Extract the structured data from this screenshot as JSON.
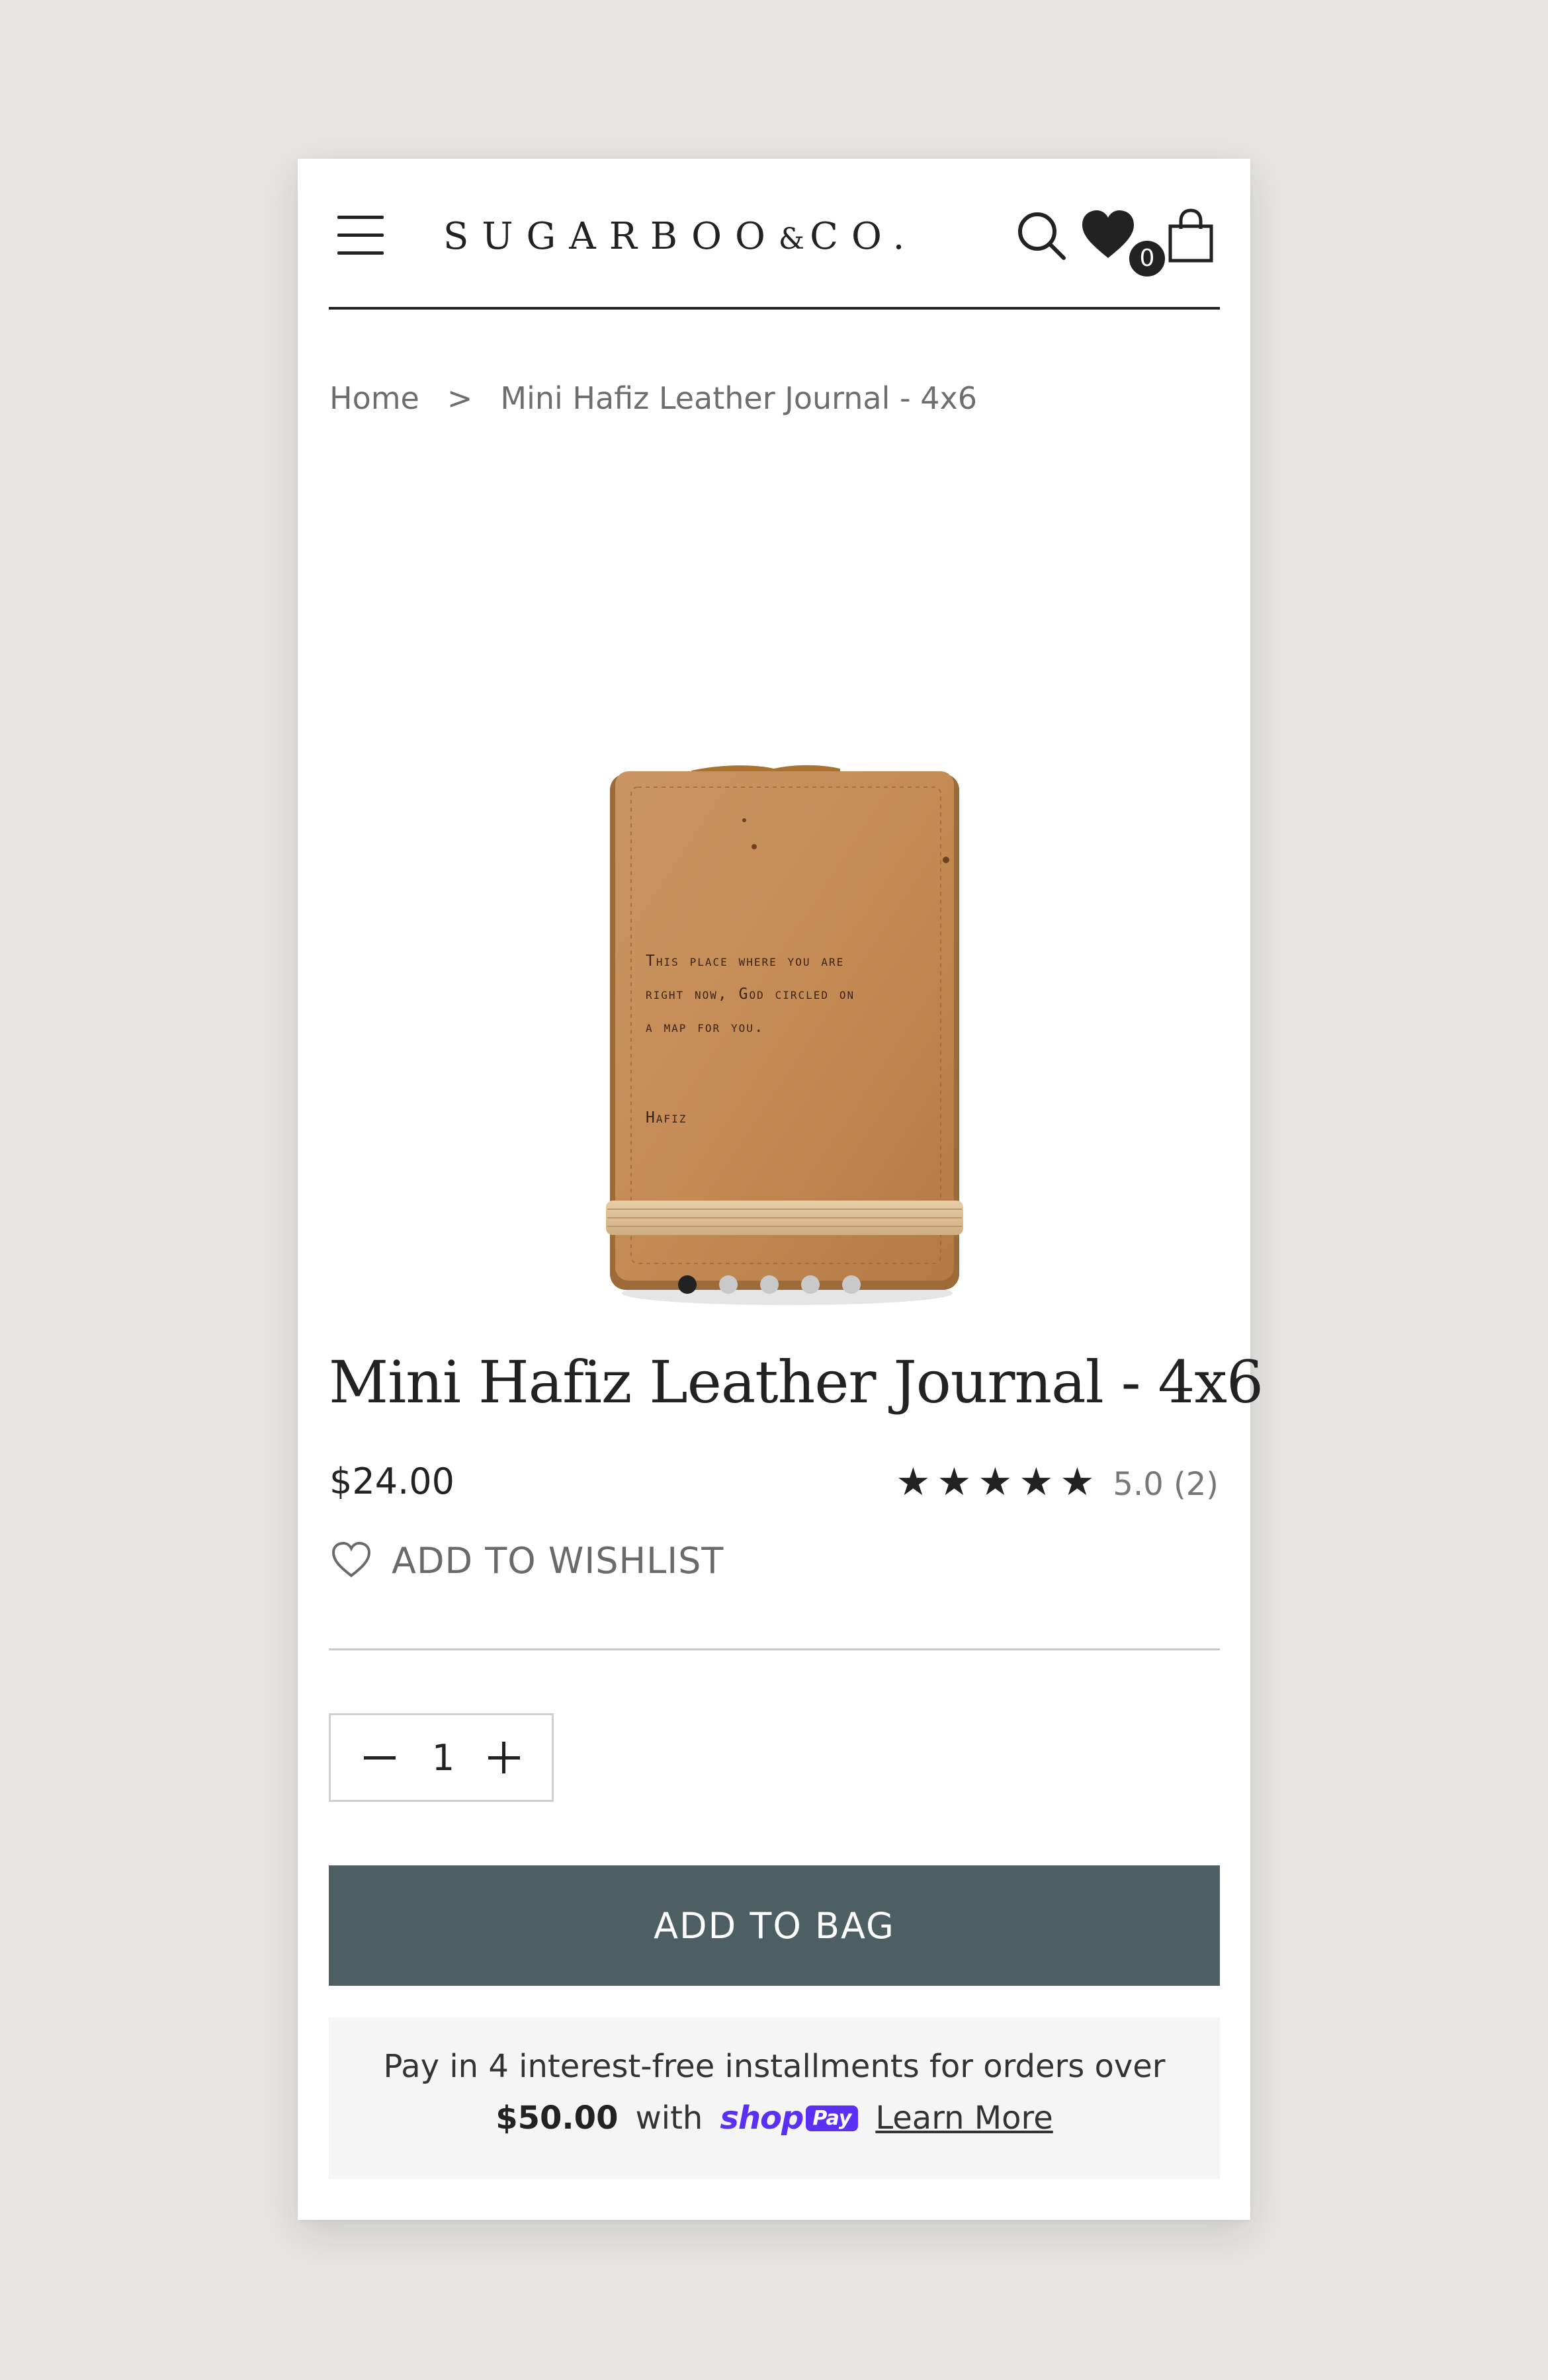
{
  "header": {
    "brand_main": "SUGARBOO",
    "brand_amp": "&",
    "brand_tail": "CO.",
    "cart_count": "0",
    "icons": [
      "menu-icon",
      "search-icon",
      "heart-icon",
      "bag-icon"
    ]
  },
  "breadcrumb": {
    "home": "Home",
    "separator": ">",
    "current": "Mini Hafiz Leather Journal - 4x6"
  },
  "product": {
    "image_text": {
      "quote_line1": "This place where you are",
      "quote_line2": "right now, God circled on",
      "quote_line3": "a map for you.",
      "author": "Hafiz"
    },
    "gallery_count": 5,
    "gallery_active": 1,
    "title": "Mini Hafiz Leather Journal - 4x6",
    "price": "$24.00",
    "rating_stars": "★★★★★",
    "rating_value": 5.0,
    "rating_text": "5.0 (2)",
    "wishlist_label": "ADD TO WISHLIST",
    "quantity": "1",
    "add_to_bag_label": "ADD TO BAG"
  },
  "installments": {
    "line1": "Pay in 4 interest-free installments for orders over",
    "amount": "$50.00",
    "with": "with",
    "shop_word": "shop",
    "pay_word": "Pay",
    "learn_more": "Learn More"
  },
  "colors": {
    "page_bg": "#e6e5e3",
    "button_bg": "#4d5f63",
    "shop_pay_purple": "#5a31f4",
    "leather": "#c08a55"
  }
}
